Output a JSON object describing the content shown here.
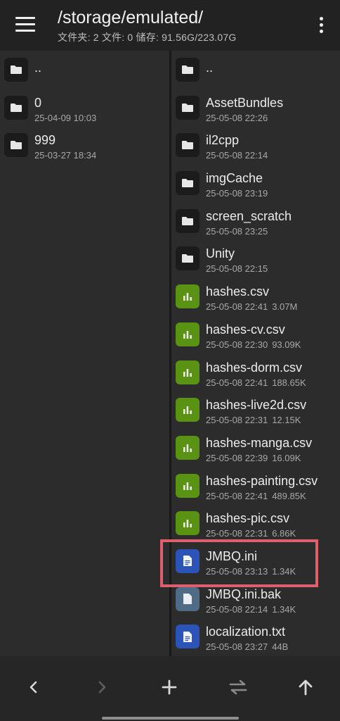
{
  "header": {
    "path": "/storage/emulated/",
    "summary": "文件夹: 2  文件: 0  储存: 91.56G/223.07G"
  },
  "left_pane": {
    "items": [
      {
        "name": "..",
        "date": "",
        "size": "",
        "type": "folder"
      },
      {
        "name": "0",
        "date": "25-04-09 10:03",
        "size": "",
        "type": "folder"
      },
      {
        "name": "999",
        "date": "25-03-27 18:34",
        "size": "",
        "type": "folder"
      }
    ]
  },
  "right_pane": {
    "items": [
      {
        "name": "..",
        "date": "",
        "size": "",
        "type": "folder"
      },
      {
        "name": "AssetBundles",
        "date": "25-05-08 22:26",
        "size": "",
        "type": "folder"
      },
      {
        "name": "il2cpp",
        "date": "25-05-08 22:14",
        "size": "",
        "type": "folder"
      },
      {
        "name": "imgCache",
        "date": "25-05-08 23:19",
        "size": "",
        "type": "folder"
      },
      {
        "name": "screen_scratch",
        "date": "25-05-08 23:25",
        "size": "",
        "type": "folder"
      },
      {
        "name": "Unity",
        "date": "25-05-08 22:15",
        "size": "",
        "type": "folder"
      },
      {
        "name": "hashes.csv",
        "date": "25-05-08 22:41",
        "size": "3.07M",
        "type": "csv"
      },
      {
        "name": "hashes-cv.csv",
        "date": "25-05-08 22:30",
        "size": "93.09K",
        "type": "csv"
      },
      {
        "name": "hashes-dorm.csv",
        "date": "25-05-08 22:41",
        "size": "188.65K",
        "type": "csv"
      },
      {
        "name": "hashes-live2d.csv",
        "date": "25-05-08 22:31",
        "size": "12.15K",
        "type": "csv"
      },
      {
        "name": "hashes-manga.csv",
        "date": "25-05-08 22:39",
        "size": "16.09K",
        "type": "csv"
      },
      {
        "name": "hashes-painting.csv",
        "date": "25-05-08 22:41",
        "size": "489.85K",
        "type": "csv"
      },
      {
        "name": "hashes-pic.csv",
        "date": "25-05-08 22:31",
        "size": "6.86K",
        "type": "csv"
      },
      {
        "name": "JMBQ.ini",
        "date": "25-05-08 23:13",
        "size": "1.34K",
        "type": "doc"
      },
      {
        "name": "JMBQ.ini.bak",
        "date": "25-05-08 22:14",
        "size": "1.34K",
        "type": "docbak"
      },
      {
        "name": "localization.txt",
        "date": "25-05-08 23:27",
        "size": "44B",
        "type": "doc"
      }
    ]
  },
  "bottom_bar": {
    "buttons": [
      "back-icon",
      "forward-icon",
      "add-icon",
      "swap-icon",
      "up-icon"
    ]
  },
  "colors": {
    "csv_icon": "#5a9214",
    "doc_icon": "#2c53b8",
    "bak_icon": "#4f6b85",
    "highlight": "#dc5f6b"
  }
}
